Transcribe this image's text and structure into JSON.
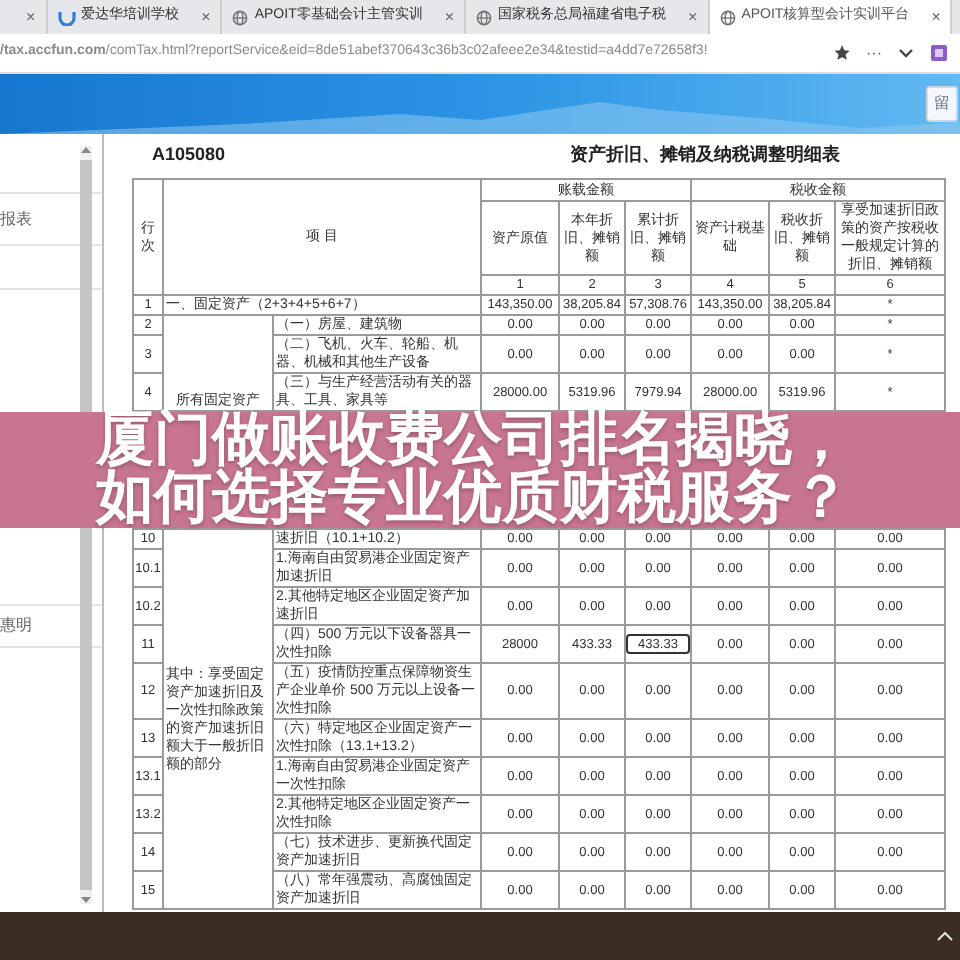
{
  "browser": {
    "tabs": [
      {
        "kind": "partial",
        "close": "×",
        "selected": false
      },
      {
        "kind": "school",
        "title": "爱达华培训学校",
        "close": "×",
        "selected": false
      },
      {
        "kind": "web",
        "title": "APOIT零基础会计主管实训",
        "close": "×",
        "selected": false
      },
      {
        "kind": "web",
        "title": "国家税务总局福建省电子税",
        "close": "×",
        "selected": false
      },
      {
        "kind": "web",
        "title": "APOIT核算型会计实训平台",
        "close": "×",
        "selected": true
      }
    ],
    "url": "**/tax.accfun.com**/comTax.html?reportService&eid=8de51abef370643c36b3c02afeee2e34&testid=a4dd7e72658f3!",
    "more_glyph": "···"
  },
  "app_header": {
    "button": "留"
  },
  "sidebar": {
    "top_items": [
      "报表"
    ],
    "bottom_items": [
      "惠明"
    ]
  },
  "form": {
    "code": "A105080",
    "title": "资产折旧、摊销及纳税调整明细表",
    "header": {
      "row_no": "行次",
      "item": "项  目",
      "book_group": "账载金额",
      "tax_group": "税收金额",
      "columns": [
        "资产原值",
        "本年折旧、摊销额",
        "累计折旧、摊销额",
        "资产计税基础",
        "税收折旧、摊销额",
        "享受加速折旧政策的资产按税收一般规定计算的折旧、摊销额"
      ],
      "numbers": [
        "1",
        "2",
        "3",
        "4",
        "5",
        "6"
      ]
    },
    "top_group": "所有固定资产",
    "top_rows": [
      {
        "kind": "total",
        "no": "1",
        "item": "一、固定资产（2+3+4+5+6+7）",
        "cells": [
          {
            "text": "143,350.00",
            "focused": false
          },
          {
            "text": "38,205.84",
            "focused": false
          },
          {
            "text": "57,308.76",
            "focused": false
          },
          {
            "text": "143,350.00",
            "focused": false
          },
          {
            "text": "38,205.84",
            "focused": false
          },
          {
            "text": "*",
            "focused": false
          }
        ]
      },
      {
        "kind": "item",
        "no": "2",
        "item": "（一）房屋、建筑物",
        "cells": [
          {
            "text": "0.00",
            "focused": false
          },
          {
            "text": "0.00",
            "focused": false
          },
          {
            "text": "0.00",
            "focused": false
          },
          {
            "text": "0.00",
            "focused": false
          },
          {
            "text": "0.00",
            "focused": false
          },
          {
            "text": "*",
            "focused": false
          }
        ]
      },
      {
        "kind": "item",
        "no": "3",
        "item": "（二）飞机、火车、轮船、机器、机械和其他生产设备",
        "cells": [
          {
            "text": "0.00",
            "focused": false
          },
          {
            "text": "0.00",
            "focused": false
          },
          {
            "text": "0.00",
            "focused": false
          },
          {
            "text": "0.00",
            "focused": false
          },
          {
            "text": "0.00",
            "focused": false
          },
          {
            "text": "*",
            "focused": false
          }
        ]
      },
      {
        "kind": "item",
        "no": "4",
        "item": "（三）与生产经营活动有关的器具、工具、家具等",
        "cells": [
          {
            "text": "28000.00",
            "focused": false
          },
          {
            "text": "5319.96",
            "focused": false
          },
          {
            "text": "7979.94",
            "focused": false
          },
          {
            "text": "28000.00",
            "focused": false
          },
          {
            "text": "5319.96",
            "focused": false
          },
          {
            "text": "*",
            "focused": false
          }
        ]
      }
    ],
    "bottom_group": "其中：享受固定资产加速折旧及一次性扣除政策的资产加速折旧额大于一般折旧额的部分",
    "bottom_rows": [
      {
        "no": "10",
        "item": "速折旧（10.1+10.2）",
        "cells": [
          {
            "text": "0.00",
            "focused": false
          },
          {
            "text": "0.00",
            "focused": false
          },
          {
            "text": "0.00",
            "focused": false
          },
          {
            "text": "0.00",
            "focused": false
          },
          {
            "text": "0.00",
            "focused": false
          },
          {
            "text": "0.00",
            "focused": false
          }
        ]
      },
      {
        "no": "10.1",
        "item": "1.海南自由贸易港企业固定资产加速折旧",
        "cells": [
          {
            "text": "0.00",
            "focused": false
          },
          {
            "text": "0.00",
            "focused": false
          },
          {
            "text": "0.00",
            "focused": false
          },
          {
            "text": "0.00",
            "focused": false
          },
          {
            "text": "0.00",
            "focused": false
          },
          {
            "text": "0.00",
            "focused": false
          }
        ]
      },
      {
        "no": "10.2",
        "item": "2.其他特定地区企业固定资产加速折旧",
        "cells": [
          {
            "text": "0.00",
            "focused": false
          },
          {
            "text": "0.00",
            "focused": false
          },
          {
            "text": "0.00",
            "focused": false
          },
          {
            "text": "0.00",
            "focused": false
          },
          {
            "text": "0.00",
            "focused": false
          },
          {
            "text": "0.00",
            "focused": false
          }
        ]
      },
      {
        "no": "11",
        "item": "（四）500 万元以下设备器具一次性扣除",
        "cells": [
          {
            "text": "28000",
            "focused": false
          },
          {
            "text": "433.33",
            "focused": false
          },
          {
            "text": "433.33",
            "focused": true
          },
          {
            "text": "0.00",
            "focused": false
          },
          {
            "text": "0.00",
            "focused": false
          },
          {
            "text": "0.00",
            "focused": false
          }
        ]
      },
      {
        "no": "12",
        "item": "（五）疫情防控重点保障物资生产企业单价 500 万元以上设备一次性扣除",
        "cells": [
          {
            "text": "0.00",
            "focused": false
          },
          {
            "text": "0.00",
            "focused": false
          },
          {
            "text": "0.00",
            "focused": false
          },
          {
            "text": "0.00",
            "focused": false
          },
          {
            "text": "0.00",
            "focused": false
          },
          {
            "text": "0.00",
            "focused": false
          }
        ]
      },
      {
        "no": "13",
        "item": "（六）特定地区企业固定资产一次性扣除（13.1+13.2）",
        "cells": [
          {
            "text": "0.00",
            "focused": false
          },
          {
            "text": "0.00",
            "focused": false
          },
          {
            "text": "0.00",
            "focused": false
          },
          {
            "text": "0.00",
            "focused": false
          },
          {
            "text": "0.00",
            "focused": false
          },
          {
            "text": "0.00",
            "focused": false
          }
        ]
      },
      {
        "no": "13.1",
        "item": "1.海南自由贸易港企业固定资产一次性扣除",
        "cells": [
          {
            "text": "0.00",
            "focused": false
          },
          {
            "text": "0.00",
            "focused": false
          },
          {
            "text": "0.00",
            "focused": false
          },
          {
            "text": "0.00",
            "focused": false
          },
          {
            "text": "0.00",
            "focused": false
          },
          {
            "text": "0.00",
            "focused": false
          }
        ]
      },
      {
        "no": "13.2",
        "item": "2.其他特定地区企业固定资产一次性扣除",
        "cells": [
          {
            "text": "0.00",
            "focused": false
          },
          {
            "text": "0.00",
            "focused": false
          },
          {
            "text": "0.00",
            "focused": false
          },
          {
            "text": "0.00",
            "focused": false
          },
          {
            "text": "0.00",
            "focused": false
          },
          {
            "text": "0.00",
            "focused": false
          }
        ]
      },
      {
        "no": "14",
        "item": "（七）技术进步、更新换代固定资产加速折旧",
        "cells": [
          {
            "text": "0.00",
            "focused": false
          },
          {
            "text": "0.00",
            "focused": false
          },
          {
            "text": "0.00",
            "focused": false
          },
          {
            "text": "0.00",
            "focused": false
          },
          {
            "text": "0.00",
            "focused": false
          },
          {
            "text": "0.00",
            "focused": false
          }
        ]
      },
      {
        "no": "15",
        "item": "（八）常年强震动、高腐蚀固定资产加速折旧",
        "cells": [
          {
            "text": "0.00",
            "focused": false
          },
          {
            "text": "0.00",
            "focused": false
          },
          {
            "text": "0.00",
            "focused": false
          },
          {
            "text": "0.00",
            "focused": false
          },
          {
            "text": "0.00",
            "focused": false
          },
          {
            "text": "0.00",
            "focused": false
          }
        ]
      }
    ]
  },
  "banner": {
    "lines": [
      "厦门做账收费公司排名揭晓，",
      "如何选择专业优质财税服务？"
    ]
  }
}
